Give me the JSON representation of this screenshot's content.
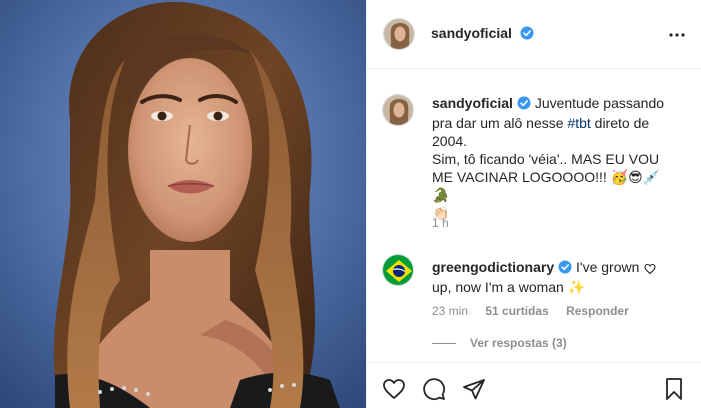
{
  "post": {
    "username": "sandyoficial",
    "verified": true
  },
  "caption": {
    "username": "sandyoficial",
    "line1_pre": "Juventude passando",
    "line2_pre": "pra dar um alô nesse ",
    "hashtag": "#tbt",
    "line2_post": " direto de",
    "line3": "2004.",
    "line4": "Sim, tô ficando 'véia'.. MAS EU VOU",
    "line5": "ME VACINAR LOGOOOO!!! 🥳😎💉🐊",
    "line6": "👏🏻",
    "time": "1 h"
  },
  "comment": {
    "username": "greengodictionary",
    "text_line1": "I've grown",
    "text_line2": "up, now I'm a woman ✨",
    "time": "23 min",
    "likes": "51 curtidas",
    "reply": "Responder"
  },
  "replies": {
    "label": "Ver respostas (3)"
  },
  "colors": {
    "verified_blue": "#3897f0",
    "link_blue": "#00376b",
    "secondary_gray": "#8e8e8e",
    "border": "#efefef"
  },
  "icons": [
    "more-options-icon",
    "verified-badge-icon",
    "heart-icon",
    "comment-icon",
    "share-icon",
    "bookmark-icon",
    "like-comment-icon",
    "brazil-flag-avatar"
  ]
}
